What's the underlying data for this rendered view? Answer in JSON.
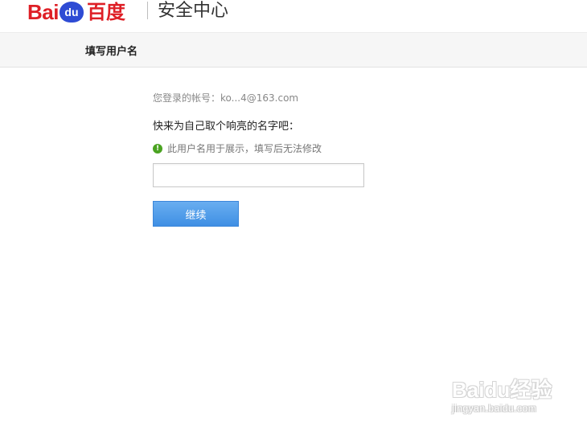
{
  "header": {
    "logo_text_a": "Bai",
    "logo_text_paw": "du",
    "logo_text_cn": "百度",
    "title": "安全中心"
  },
  "subbar": {
    "title": "填写用户名"
  },
  "main": {
    "account_label": "您登录的帐号：",
    "account_value": "ko...4@163.com",
    "prompt": "快来为自己取个响亮的名字吧：",
    "hint": "此用户名用于展示，填写后无法修改",
    "hint_icon": "!",
    "username_value": "",
    "continue_label": "继续"
  },
  "watermark": {
    "main": "Baidu经验",
    "sub": "jingyan.baidu.com"
  },
  "colors": {
    "brand_red": "#de1f26",
    "brand_blue": "#2e4bd4",
    "button_blue": "#3f8fe4",
    "hint_green": "#4aa321"
  }
}
